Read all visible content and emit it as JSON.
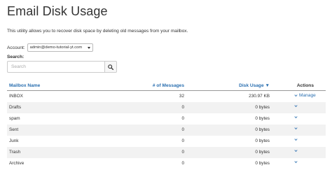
{
  "page": {
    "title": "Email Disk Usage",
    "description": "This utility allows you to recover disk space by deleting old messages from your mailbox."
  },
  "account": {
    "label": "Account:",
    "selected": "admin@demo-tutorial-yt.com"
  },
  "search": {
    "label": "Search:",
    "placeholder": "Search"
  },
  "table": {
    "headers": {
      "name": "Mailbox Name",
      "messages": "# of Messages",
      "disk": "Disk Usage ▼",
      "actions": "Actions"
    },
    "rows": [
      {
        "name": "INBOX",
        "messages": "32",
        "disk": "230.97 KB",
        "action": "Manage"
      },
      {
        "name": "Drafts",
        "messages": "0",
        "disk": "0 bytes",
        "action": ""
      },
      {
        "name": "spam",
        "messages": "0",
        "disk": "0 bytes",
        "action": ""
      },
      {
        "name": "Sent",
        "messages": "0",
        "disk": "0 bytes",
        "action": ""
      },
      {
        "name": "Junk",
        "messages": "0",
        "disk": "0 bytes",
        "action": ""
      },
      {
        "name": "Trash",
        "messages": "0",
        "disk": "0 bytes",
        "action": ""
      },
      {
        "name": "Archive",
        "messages": "0",
        "disk": "0 bytes",
        "action": ""
      }
    ]
  },
  "colors": {
    "link": "#2a6fb0",
    "row_alt": "#f2f2f2"
  },
  "icons": {
    "search": "search-icon",
    "row_action": "chevron-down-icon",
    "select_caret": "caret-down-icon"
  }
}
